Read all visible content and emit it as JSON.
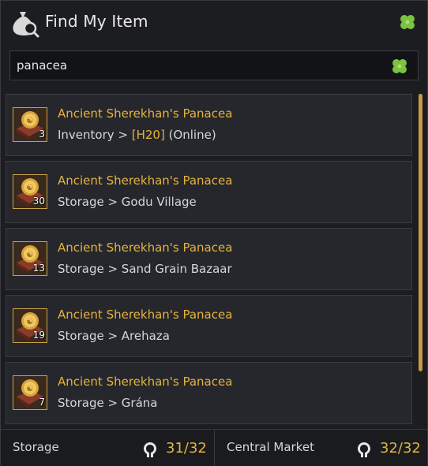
{
  "header": {
    "title": "Find My Item",
    "icon": "money-bag-search-icon",
    "action_icon": "clover-icon"
  },
  "search": {
    "value": "panacea",
    "placeholder": "",
    "action_icon": "clover-icon"
  },
  "results": [
    {
      "name": "Ancient Sherekhan's Panacea",
      "qty": "3",
      "location_prefix": "Inventory > ",
      "location_highlight": "[H20]",
      "location_suffix": " (Online)"
    },
    {
      "name": "Ancient Sherekhan's Panacea",
      "qty": "30",
      "location_prefix": "Storage > Godu Village",
      "location_highlight": "",
      "location_suffix": ""
    },
    {
      "name": "Ancient Sherekhan's Panacea",
      "qty": "13",
      "location_prefix": "Storage > Sand Grain Bazaar",
      "location_highlight": "",
      "location_suffix": ""
    },
    {
      "name": "Ancient Sherekhan's Panacea",
      "qty": "19",
      "location_prefix": "Storage > Arehaza",
      "location_highlight": "",
      "location_suffix": ""
    },
    {
      "name": "Ancient Sherekhan's Panacea",
      "qty": "7",
      "location_prefix": "Storage > Grána",
      "location_highlight": "",
      "location_suffix": ""
    }
  ],
  "footer": {
    "storage_label": "Storage",
    "storage_count": "31/32",
    "market_label": "Central Market",
    "market_count": "32/32"
  },
  "colors": {
    "accent_gold": "#e4b33e",
    "clover_green": "#7cc242",
    "text": "#d6d6d6"
  }
}
